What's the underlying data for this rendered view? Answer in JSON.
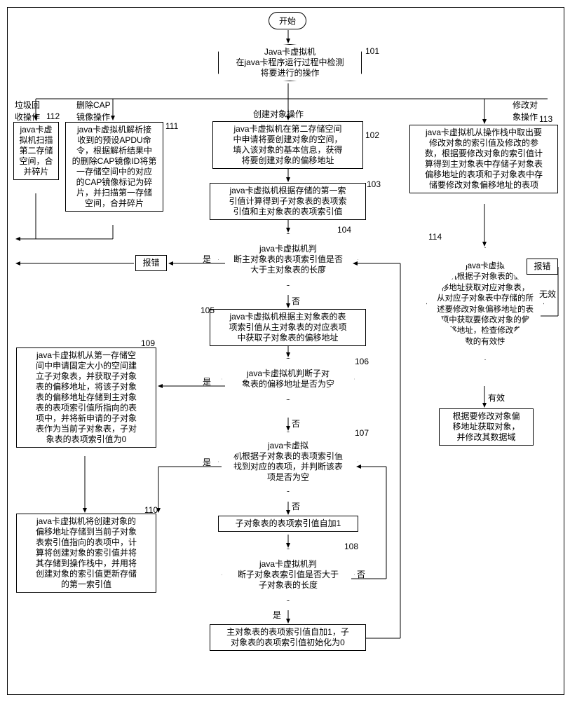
{
  "start": "开始",
  "n101": "Java卡虚拟机\n在java卡程序运行过程中检测\n将要进行的操作",
  "branch_gc": "垃圾回\n收操作",
  "branch_delcap": "删除CAP\n镜像操作",
  "branch_create": "创建对象操作",
  "branch_modify": "修改对\n象操作",
  "n112": "java卡虚\n拟机扫描\n第二存储\n空间，合\n并碎片",
  "n111": "java卡虚拟机解析接\n收到的预设APDU命\n令，根据解析结果中\n的删除CAP镜像ID将第\n一存储空间中的对应\n的CAP镜像标记为碎\n片，并扫描第一存储\n空间，合并碎片",
  "n102": "java卡虚拟机在第二存储空间\n中申请将要创建对象的空间，\n填入该对象的基本信息，获得\n将要创建对象的偏移地址",
  "n103": "java卡虚拟机根据存储的第一索\n引值计算得到子对象表的表项索\n引值和主对象表的表项索引值",
  "n104": "java卡虚拟机判\n断主对象表的表项索引值是否\n大于主对象表的长度",
  "err_left": "报错",
  "n105": "java卡虚拟机根据主对象表的表\n项索引值从主对象表的对应表项\n中获取子对象表的偏移地址",
  "n106": "java卡虚拟机判断子对\n象表的偏移地址是否为空",
  "n109": "java卡虚拟机从第一存储空\n间中申请固定大小的空间建\n立子对象表，并获取子对象\n表的偏移地址，将该子对象\n表的偏移地址存储到主对象\n表的表项索引值所指向的表\n项中，并将新申请的子对象\n表作为当前子对象表，子对\n象表的表项索引值为0",
  "n107": "java卡虚拟\n机根据子对象表的表项索引值\n找到对应的表项，并判断该表\n项是否为空",
  "n110": "java卡虚拟机将创建对象的\n偏移地址存储到当前子对象\n表索引值指向的表项中，计\n算将创建对象的索引值并将\n其存储到操作栈中，并用将\n创建对象的索引值更新存储\n的第一索引值",
  "n107b": "子对象表的表项索引值自加1",
  "n108": "java卡虚拟机判\n断子对象表索引值是否大于\n子对象表的长度",
  "n108b": "主对象表的表项索引值自加1，子\n对象表的表项索引值初始化为0",
  "n113": "java卡虚拟机从操作栈中取出要\n修改对象的索引值及修改的参\n数，根据要修改对象的索引值计\n算得到主对象表中存储子对象表\n偏移地址的表项和子对象表中存\n储要修改对象偏移地址的表项",
  "n114": "java卡虚拟\n机根据子对象表的偏\n移地址获取对应对象表，\n从对应子对象表中存储的所\n述要修改对象偏移地址的表\n项中获取要修改对象的偏\n移地址，检查修改参\n数的有效性",
  "err_right": "报错",
  "n115": "根据要修改对象偏\n移地址获取对象，\n并修改其数据域",
  "yes": "是",
  "no": "否",
  "valid": "有效",
  "invalid": "无效",
  "nums": {
    "101": "101",
    "102": "102",
    "103": "103",
    "104": "104",
    "105": "105",
    "106": "106",
    "107": "107",
    "108": "108",
    "109": "109",
    "110": "110",
    "111": "111",
    "112": "112",
    "113": "113",
    "114": "114"
  }
}
